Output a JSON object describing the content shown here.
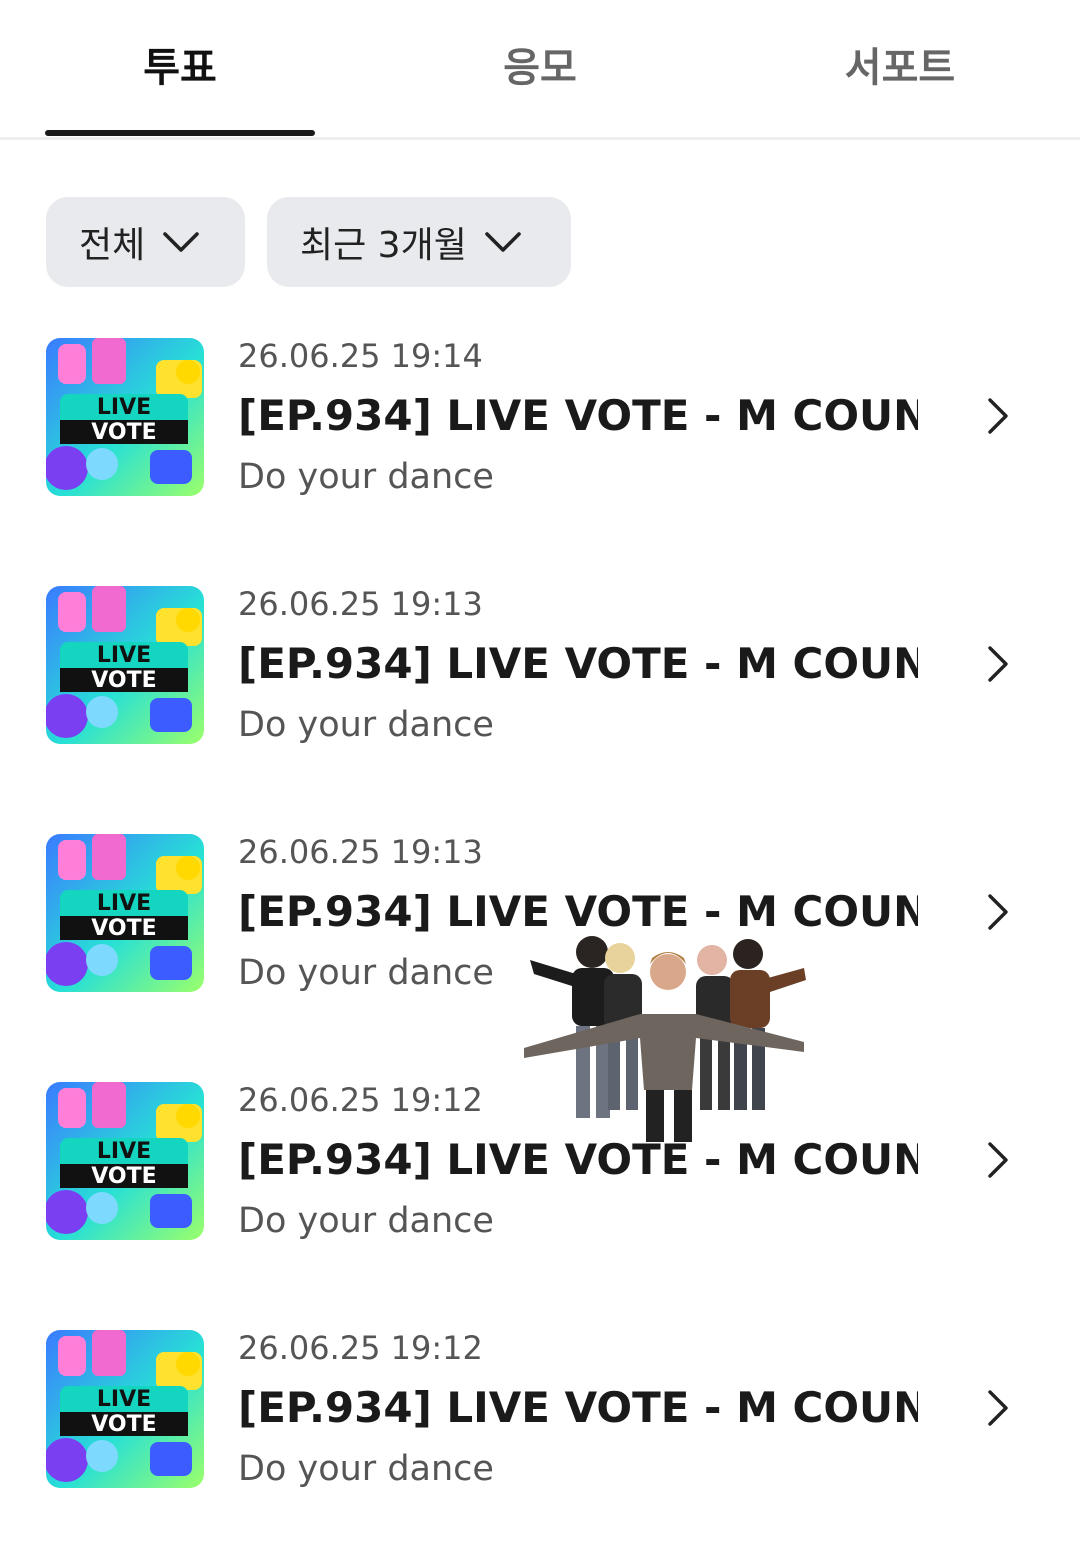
{
  "tabs": [
    {
      "label": "투표",
      "active": true
    },
    {
      "label": "응모",
      "active": false
    },
    {
      "label": "서포트",
      "active": false
    }
  ],
  "filters": {
    "category": "전체",
    "period": "최근 3개월"
  },
  "thumbnail": {
    "line1": "LIVE",
    "line2": "VOTE"
  },
  "items": [
    {
      "date": "26.06.25 19:14",
      "title": "[EP.934] LIVE VOTE - M COUN...",
      "subtitle": "Do your dance"
    },
    {
      "date": "26.06.25 19:13",
      "title": "[EP.934] LIVE VOTE - M COUN...",
      "subtitle": "Do your dance"
    },
    {
      "date": "26.06.25 19:13",
      "title": "[EP.934] LIVE VOTE - M COUN...",
      "subtitle": "Do your dance"
    },
    {
      "date": "26.06.25 19:12",
      "title": "[EP.934] LIVE VOTE - M COUN...",
      "subtitle": "Do your dance"
    },
    {
      "date": "26.06.25 19:12",
      "title": "[EP.934] LIVE VOTE - M COUN...",
      "subtitle": "Do your dance"
    }
  ],
  "colors": {
    "active_tab": "#111111",
    "inactive_tab": "#666666",
    "filter_bg": "#e9eaed",
    "thumb_cyan": "#27e0d6",
    "thumb_blue": "#3a7bff",
    "thumb_yellow": "#ffe12e",
    "thumb_pink": "#ff7fd8"
  },
  "icons": {
    "dropdown": "chevron-down-icon",
    "row_arrow": "chevron-right-icon"
  }
}
